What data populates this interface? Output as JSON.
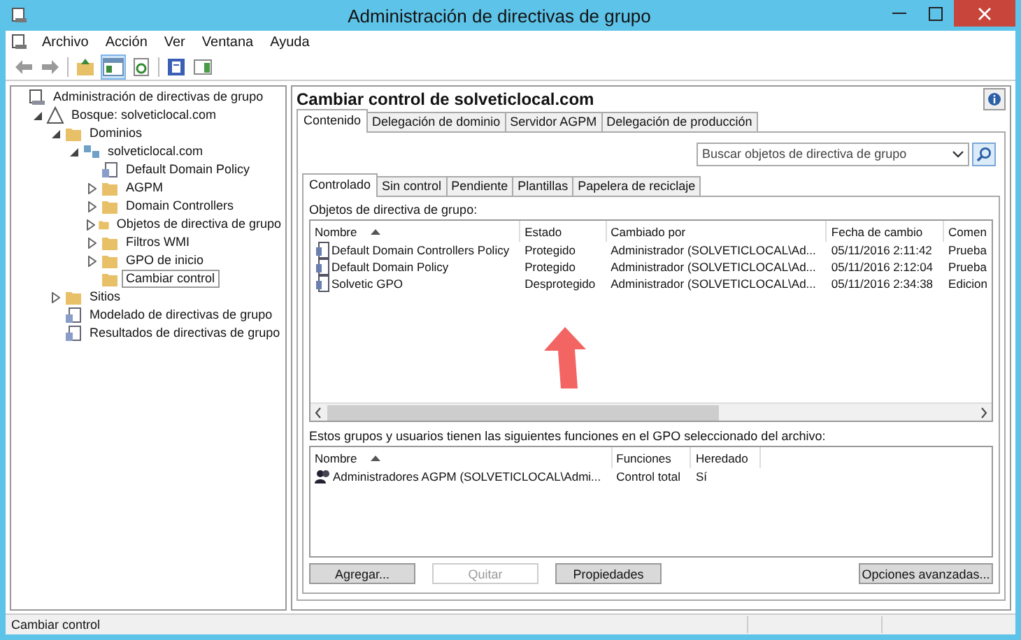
{
  "window": {
    "title": "Administración de directivas de grupo"
  },
  "menu": [
    "Archivo",
    "Acción",
    "Ver",
    "Ventana",
    "Ayuda"
  ],
  "tree": [
    {
      "label": "Administración de directivas de grupo",
      "kind": "console",
      "children": [
        {
          "label": "Bosque: solveticlocal.com",
          "kind": "forest",
          "expanded": true,
          "children": [
            {
              "label": "Dominios",
              "kind": "folder",
              "expanded": true,
              "children": [
                {
                  "label": "solveticlocal.com",
                  "kind": "domain",
                  "expanded": true,
                  "children": [
                    {
                      "label": "Default Domain Policy",
                      "kind": "policy"
                    },
                    {
                      "label": "AGPM",
                      "kind": "folder",
                      "expanded": false
                    },
                    {
                      "label": "Domain Controllers",
                      "kind": "folder",
                      "expanded": false
                    },
                    {
                      "label": "Objetos de directiva de grupo",
                      "kind": "folder",
                      "expanded": false
                    },
                    {
                      "label": "Filtros WMI",
                      "kind": "folder",
                      "expanded": false
                    },
                    {
                      "label": "GPO de inicio",
                      "kind": "folder",
                      "expanded": false
                    },
                    {
                      "label": "Cambiar control",
                      "kind": "folder",
                      "selected": true
                    }
                  ]
                }
              ]
            },
            {
              "label": "Sitios",
              "kind": "folder",
              "expanded": false
            },
            {
              "label": "Modelado de directivas de grupo",
              "kind": "policy"
            },
            {
              "label": "Resultados de directivas de grupo",
              "kind": "policy"
            }
          ]
        }
      ]
    }
  ],
  "panel": {
    "title": "Cambiar control de solveticlocal.com",
    "tabs": [
      {
        "label": "Contenido",
        "selected": true
      },
      {
        "label": "Delegación de dominio",
        "selected": false
      },
      {
        "label": "Servidor AGPM",
        "selected": false
      },
      {
        "label": "Delegación de producción",
        "selected": false
      }
    ],
    "search": {
      "placeholder": "Buscar objetos de directiva de grupo"
    },
    "subtabs": [
      {
        "label": "Controlado",
        "selected": true
      },
      {
        "label": "Sin control",
        "selected": false
      },
      {
        "label": "Pendiente",
        "selected": false
      },
      {
        "label": "Plantillas",
        "selected": false
      },
      {
        "label": "Papelera de reciclaje",
        "selected": false
      }
    ],
    "gpo_label": "Objetos de directiva de grupo:",
    "gpo_table": {
      "columns": [
        "Nombre",
        "Estado",
        "Cambiado por",
        "Fecha de cambio",
        "Comen"
      ],
      "rows": [
        [
          "Default Domain Controllers Policy",
          "Protegido",
          "Administrador (SOLVETICLOCAL\\Ad...",
          "05/11/2016 2:11:42",
          "Prueba"
        ],
        [
          "Default Domain Policy",
          "Protegido",
          "Administrador (SOLVETICLOCAL\\Ad...",
          "05/11/2016 2:12:04",
          "Prueba"
        ],
        [
          "Solvetic GPO",
          "Desprotegido",
          "Administrador (SOLVETICLOCAL\\Ad...",
          "05/11/2016 2:34:38",
          "Edicion"
        ]
      ]
    },
    "roles_label": "Estos grupos y usuarios tienen las siguientes funciones en el GPO seleccionado del archivo:",
    "roles_table": {
      "columns": [
        "Nombre",
        "Funciones",
        "Heredado"
      ],
      "rows": [
        [
          "Administradores AGPM (SOLVETICLOCAL\\Admi...",
          "Control total",
          "Sí"
        ]
      ]
    },
    "buttons": [
      {
        "label": "Agregar...",
        "disabled": false
      },
      {
        "label": "Quitar",
        "disabled": true
      },
      {
        "label": "Propiedades",
        "disabled": false
      }
    ],
    "advanced_button": {
      "label": "Opciones avanzadas...",
      "disabled": false
    }
  },
  "status_bar": "Cambiar control"
}
